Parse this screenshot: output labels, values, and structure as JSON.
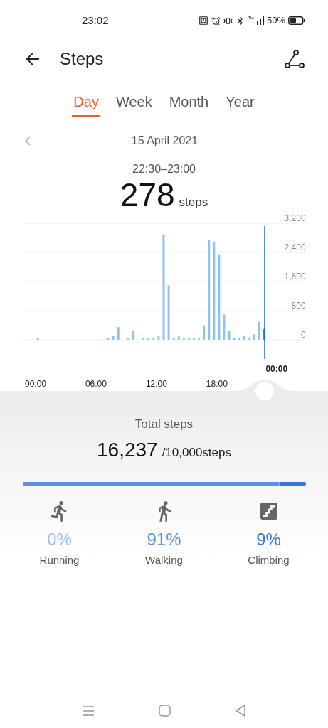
{
  "status_bar": {
    "time": "23:02",
    "network": "4G",
    "battery": "50%"
  },
  "header": {
    "title": "Steps"
  },
  "tabs": [
    {
      "label": "Day",
      "selected": true
    },
    {
      "label": "Week",
      "selected": false
    },
    {
      "label": "Month",
      "selected": false
    },
    {
      "label": "Year",
      "selected": false
    }
  ],
  "date": "15 April 2021",
  "reading": {
    "range": "22:30–23:00",
    "value": "278",
    "unit": "steps"
  },
  "chart": {
    "slider_label": "00:00",
    "chart_data": {
      "type": "bar",
      "grid": true,
      "x": [
        0,
        7,
        7.5,
        8,
        9,
        9.5,
        10.5,
        11,
        11.5,
        12,
        12.5,
        13,
        13.5,
        14,
        14.5,
        15,
        15.5,
        16,
        16.5,
        17,
        17.5,
        18,
        18.5,
        19,
        19.5,
        20,
        20.5,
        21,
        21.5,
        22,
        22.5
      ],
      "values": [
        50,
        50,
        100,
        350,
        50,
        250,
        50,
        50,
        50,
        100,
        2900,
        1500,
        50,
        100,
        50,
        50,
        50,
        50,
        400,
        2750,
        2700,
        2350,
        700,
        250,
        50,
        50,
        100,
        50,
        150,
        500,
        300
      ],
      "xlim": [
        -1.5,
        26.6
      ],
      "xticks": [
        {
          "value": 0,
          "label": "00:00"
        },
        {
          "value": 6,
          "label": "06:00"
        },
        {
          "value": 12,
          "label": "12:00"
        },
        {
          "value": 18,
          "label": "18:00"
        }
      ],
      "yticks": [
        {
          "value": 0,
          "label": "0"
        },
        {
          "value": 800,
          "label": "800"
        },
        {
          "value": 1600,
          "label": "1,600"
        },
        {
          "value": 2400,
          "label": "2,400"
        },
        {
          "value": 3200,
          "label": "3,200"
        }
      ],
      "ylim": [
        0,
        3200
      ]
    }
  },
  "total": {
    "label": "Total steps",
    "value": "16,237",
    "goal": "/10,000steps"
  },
  "share_bar": {
    "level": 0.91
  },
  "activities": [
    {
      "kind": "running",
      "percent": "0%",
      "label": "Running",
      "color": "#9dbfeb"
    },
    {
      "kind": "walking",
      "percent": "91%",
      "label": "Walking",
      "color": "#5b92e2"
    },
    {
      "kind": "climbing",
      "percent": "9%",
      "label": "Climbing",
      "color": "#3a78d8"
    }
  ]
}
